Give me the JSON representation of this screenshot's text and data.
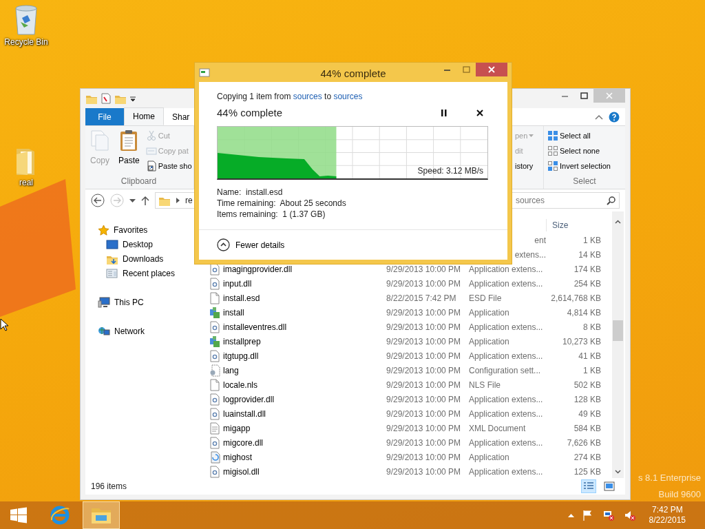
{
  "desktop": {
    "icons": [
      {
        "kind": "recycle-bin",
        "label": "Recycle Bin"
      },
      {
        "kind": "folder",
        "label": "real"
      }
    ],
    "watermark": [
      "s 8.1 Enterprise",
      "Build 9600"
    ]
  },
  "explorer": {
    "ribbon_tabs": [
      {
        "label": "File",
        "kind": "file",
        "selected": false
      },
      {
        "label": "Home",
        "kind": "tab",
        "selected": true
      },
      {
        "label": "Shar",
        "kind": "tab",
        "selected": false
      }
    ],
    "ribbon_groups": [
      {
        "label": "Clipboard",
        "items": [
          {
            "kind": "large",
            "label": "Copy",
            "disabled": true
          },
          {
            "kind": "large",
            "label": "Paste",
            "disabled": false
          },
          {
            "kind": "small",
            "label": "Cut",
            "disabled": true
          },
          {
            "kind": "small",
            "label": "Copy pat",
            "disabled": true
          },
          {
            "kind": "small",
            "label": "Paste sho",
            "disabled": false
          }
        ]
      },
      {
        "items": [
          {
            "kind": "small",
            "label": "pen",
            "disabled": true,
            "dropdown": true
          },
          {
            "kind": "small",
            "label": "dit",
            "disabled": true
          },
          {
            "kind": "small",
            "label": "istory",
            "disabled": false
          }
        ]
      },
      {
        "label": "Select",
        "items": [
          {
            "kind": "small",
            "label": "Select all",
            "disabled": false
          },
          {
            "kind": "small",
            "label": "Select none",
            "disabled": false
          },
          {
            "kind": "small",
            "label": "Invert selection",
            "disabled": false
          }
        ]
      }
    ],
    "address": {
      "path": "re"
    },
    "search": {
      "placeholder": "sources"
    },
    "nav": [
      {
        "label": "Favorites",
        "children": [
          {
            "label": "Desktop"
          },
          {
            "label": "Downloads"
          },
          {
            "label": "Recent places"
          }
        ]
      },
      {
        "label": "This PC"
      },
      {
        "label": "Network"
      }
    ],
    "size_header": "Size",
    "rows": [
      {
        "kind": "partial",
        "type": "ent",
        "size": "1 KB"
      },
      {
        "kind": "partial",
        "type": "extens...",
        "size": "14 KB"
      },
      {
        "kind": "dll",
        "name": "imagingprovider.dll",
        "date": "9/29/2013 10:00 PM",
        "type": "Application extens...",
        "size": "174 KB"
      },
      {
        "kind": "dll",
        "name": "input.dll",
        "date": "9/29/2013 10:00 PM",
        "type": "Application extens...",
        "size": "254 KB"
      },
      {
        "kind": "blank",
        "name": "install.esd",
        "date": "8/22/2015 7:42 PM",
        "type": "ESD File",
        "size": "2,614,768 KB"
      },
      {
        "kind": "app",
        "name": "install",
        "date": "9/29/2013 10:00 PM",
        "type": "Application",
        "size": "4,814 KB"
      },
      {
        "kind": "dll",
        "name": "installeventres.dll",
        "date": "9/29/2013 10:00 PM",
        "type": "Application extens...",
        "size": "8 KB"
      },
      {
        "kind": "app",
        "name": "installprep",
        "date": "9/29/2013 10:00 PM",
        "type": "Application",
        "size": "10,273 KB"
      },
      {
        "kind": "dll",
        "name": "itgtupg.dll",
        "date": "9/29/2013 10:00 PM",
        "type": "Application extens...",
        "size": "41 KB"
      },
      {
        "kind": "config",
        "name": "lang",
        "date": "9/29/2013 10:00 PM",
        "type": "Configuration sett...",
        "size": "1 KB"
      },
      {
        "kind": "blank",
        "name": "locale.nls",
        "date": "9/29/2013 10:00 PM",
        "type": "NLS File",
        "size": "502 KB"
      },
      {
        "kind": "dll",
        "name": "logprovider.dll",
        "date": "9/29/2013 10:00 PM",
        "type": "Application extens...",
        "size": "128 KB"
      },
      {
        "kind": "dll",
        "name": "luainstall.dll",
        "date": "9/29/2013 10:00 PM",
        "type": "Application extens...",
        "size": "49 KB"
      },
      {
        "kind": "xml",
        "name": "migapp",
        "date": "9/29/2013 10:00 PM",
        "type": "XML Document",
        "size": "584 KB"
      },
      {
        "kind": "dll",
        "name": "migcore.dll",
        "date": "9/29/2013 10:00 PM",
        "type": "Application extens...",
        "size": "7,626 KB"
      },
      {
        "kind": "host",
        "name": "mighost",
        "date": "9/29/2013 10:00 PM",
        "type": "Application",
        "size": "274 KB"
      },
      {
        "kind": "dll",
        "name": "migisol.dll",
        "date": "9/29/2013 10:00 PM",
        "type": "Application extens...",
        "size": "125 KB"
      }
    ],
    "status": "196 items",
    "view_buttons": [
      {
        "kind": "details",
        "selected": true
      },
      {
        "kind": "large-icons",
        "selected": false
      }
    ]
  },
  "copy_dialog": {
    "title": "44% complete",
    "summary": {
      "before": "Copying 1 item from",
      "source": "sources",
      "middle": "to",
      "destination": "sources"
    },
    "heading": "44% complete",
    "level": 0.44,
    "speed": "Speed: 3.12 MB/s",
    "details": [
      "Name:  install.esd",
      "Time remaining:  About 25 seconds",
      "Items remaining:  1 (1.37 GB)"
    ],
    "toggle": "Fewer details"
  },
  "taskbar": {
    "apps": [
      {
        "kind": "ie",
        "active": false
      },
      {
        "kind": "explorer",
        "active": true
      }
    ],
    "time": "7:42 PM",
    "date": "8/22/2015"
  }
}
